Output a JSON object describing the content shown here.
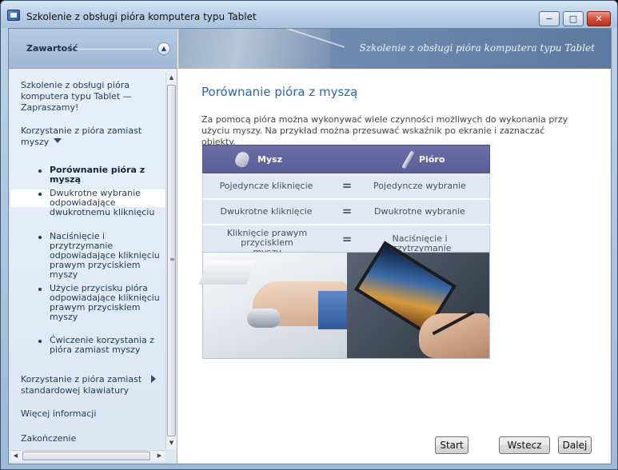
{
  "window": {
    "title": "Szkolenie z obsługi pióra komputera typu Tablet",
    "minimize": "−",
    "maximize": "□",
    "close": "✕"
  },
  "sidebar": {
    "header": "Zawartość",
    "toggle": "▲",
    "items": [
      {
        "text": "Szkolenie z obsługi pióra komputera typu Tablet — Zapraszamy!"
      },
      {
        "text": "Korzystanie z pióra zamiast myszy"
      },
      {
        "text": "Porównanie pióra z myszą"
      },
      {
        "text": "Dwukrotne wybranie odpowiadające dwukrotnemu kliknięciu"
      },
      {
        "text": "Naciśnięcie i przytrzymanie odpowiadające kliknięciu prawym przyciskiem myszy"
      },
      {
        "text": "Użycie przycisku pióra odpowiadające kliknięciu prawym przyciskiem myszy"
      },
      {
        "text": "Ćwiczenie korzystania z pióra zamiast myszy"
      },
      {
        "text": "Korzystanie z pióra zamiast standardowej klawiatury"
      },
      {
        "text": "Więcej informacji"
      },
      {
        "text": "Zakończenie"
      }
    ],
    "selected": "Porównanie pióra z myszą"
  },
  "banner": {
    "title": "Szkolenie z obsługi pióra komputera typu Tablet"
  },
  "main": {
    "heading": "Porównanie pióra z myszą",
    "intro": "Za pomocą pióra można wykonywać wiele czynności możliwych do wykonania przy użyciu myszy. Na przykład można przesuwać wskaźnik po ekranie i zaznaczać obiekty.",
    "table": {
      "col_left": "Mysz",
      "col_right": "Pióro",
      "equals": "=",
      "rows": [
        {
          "left": "Pojedyncze kliknięcie",
          "right": "Pojedyncze wybranie"
        },
        {
          "left": "Dwukrotne kliknięcie",
          "right": "Dwukrotne wybranie"
        },
        {
          "left": "Kliknięcie prawym przyciskiem myszy",
          "right": "Naciśnięcie i przytrzymanie"
        }
      ]
    }
  },
  "footer": {
    "start": "Start",
    "back": "Wstecz",
    "next": "Dalej"
  },
  "colors": {
    "heading": "#2a68b0",
    "table_header": "#5a5e98",
    "table_row": "#e2e7f4"
  }
}
